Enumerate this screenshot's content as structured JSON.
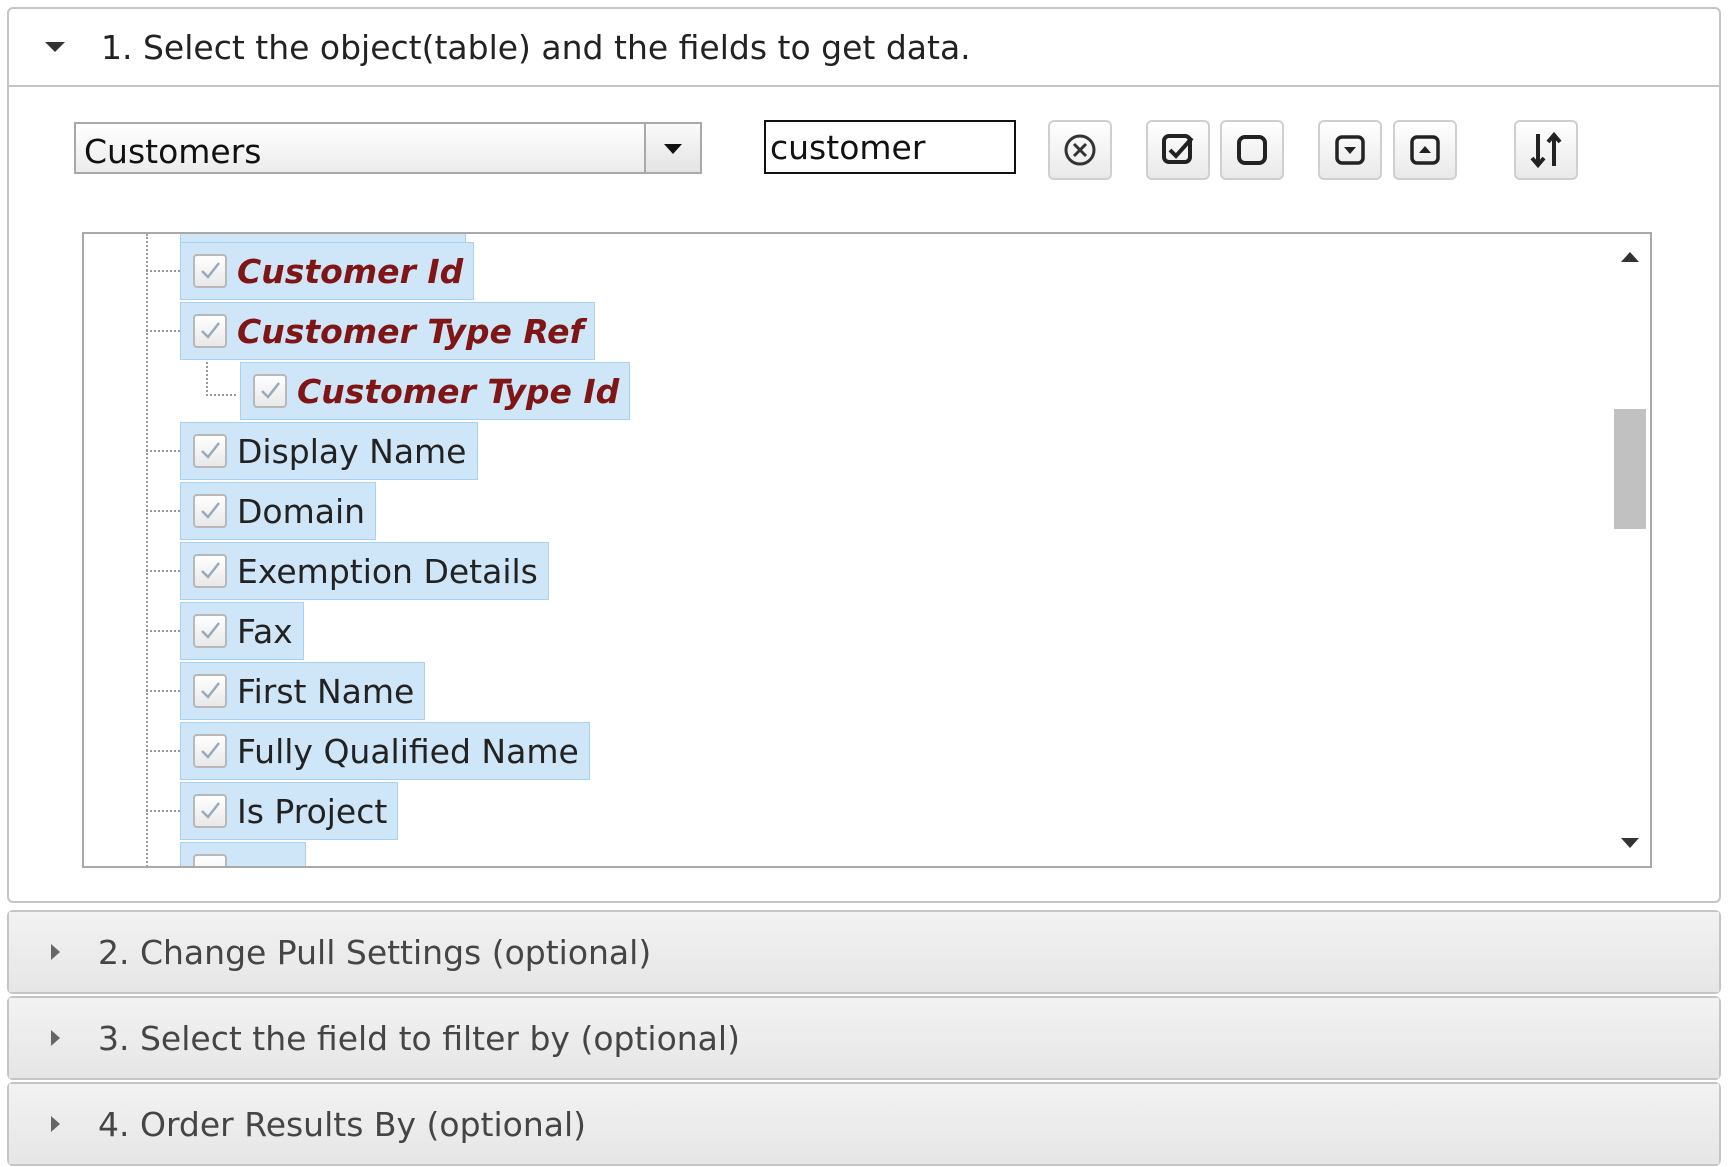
{
  "sections": [
    {
      "label": "1. Select the object(table) and the fields to get data.",
      "expanded": true
    },
    {
      "label": "2. Change Pull Settings (optional)",
      "expanded": false
    },
    {
      "label": "3. Select the field to filter by (optional)",
      "expanded": false
    },
    {
      "label": "4. Order Results By (optional)",
      "expanded": false
    }
  ],
  "object_select": {
    "value": "Customers"
  },
  "search": {
    "value": "customer"
  },
  "toolbar": {
    "icons": [
      "clear-search-icon",
      "check-all-icon",
      "uncheck-all-icon",
      "expand-all-icon",
      "collapse-all-icon",
      "sort-icon"
    ]
  },
  "tree": {
    "nodes": [
      {
        "label": "Customer Id",
        "highlight": true,
        "checked": true
      },
      {
        "label": "Customer Type Ref",
        "highlight": true,
        "checked": true
      },
      {
        "label": "Customer Type Id",
        "highlight": true,
        "checked": true
      },
      {
        "label": "Display Name",
        "highlight": false,
        "checked": true
      },
      {
        "label": "Domain",
        "highlight": false,
        "checked": true
      },
      {
        "label": "Exemption Details",
        "highlight": false,
        "checked": true
      },
      {
        "label": "Fax",
        "highlight": false,
        "checked": true
      },
      {
        "label": "First Name",
        "highlight": false,
        "checked": true
      },
      {
        "label": "Fully Qualified Name",
        "highlight": false,
        "checked": true
      },
      {
        "label": "Is Project",
        "highlight": false,
        "checked": true
      }
    ]
  },
  "colors": {
    "highlight_text": "#7f1515",
    "node_bg": "#cfe6f8"
  }
}
